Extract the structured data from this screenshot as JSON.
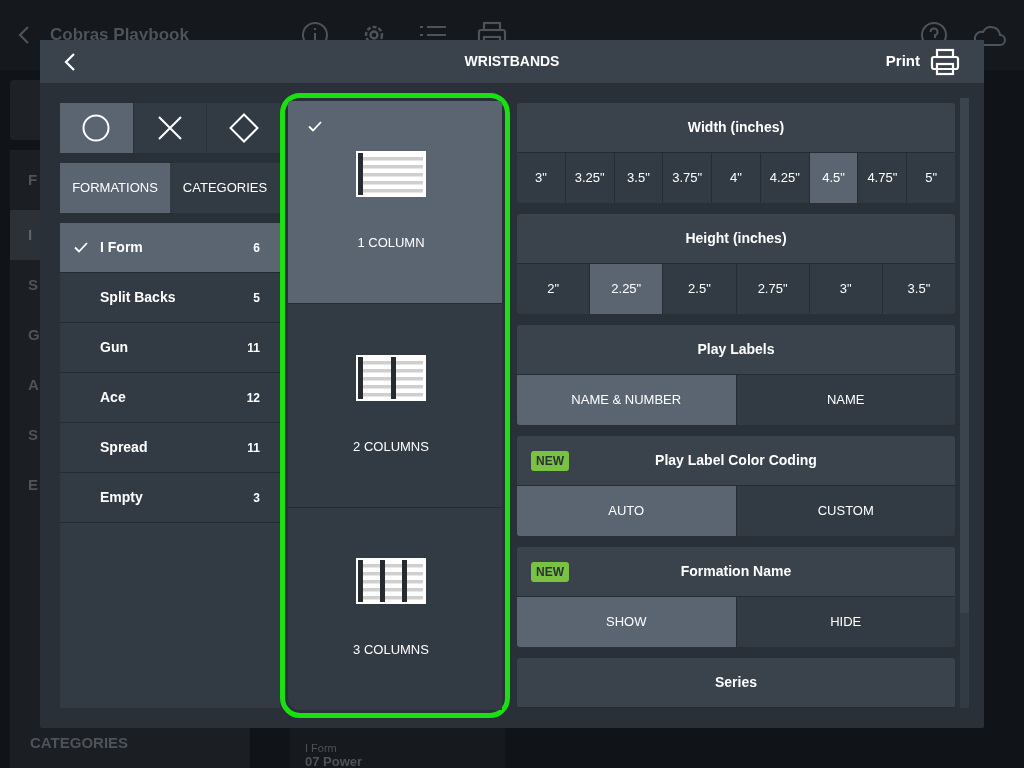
{
  "background": {
    "app_title": "Cobras Playbook",
    "sidebar_heading": "F",
    "sidebar_items": [
      {
        "label": "I",
        "selected": true
      },
      {
        "label": "S",
        "selected": false
      },
      {
        "label": "G",
        "selected": false
      },
      {
        "label": "A",
        "selected": false
      },
      {
        "label": "S",
        "selected": false
      },
      {
        "label": "E",
        "selected": false
      }
    ],
    "categories_label": "CATEGORIES",
    "card_caption": "I Form",
    "card_title": "07 Power"
  },
  "modal": {
    "title": "WRISTBANDS",
    "print_label": "Print"
  },
  "shape_tabs": [
    {
      "kind": "circle",
      "selected": true
    },
    {
      "kind": "cross",
      "selected": false
    },
    {
      "kind": "diamond",
      "selected": false
    }
  ],
  "list_tabs": [
    {
      "label": "FORMATIONS",
      "selected": true
    },
    {
      "label": "CATEGORIES",
      "selected": false
    }
  ],
  "formations": [
    {
      "name": "I Form",
      "count": "6",
      "selected": true
    },
    {
      "name": "Split Backs",
      "count": "5",
      "selected": false
    },
    {
      "name": "Gun",
      "count": "11",
      "selected": false
    },
    {
      "name": "Ace",
      "count": "12",
      "selected": false
    },
    {
      "name": "Spread",
      "count": "11",
      "selected": false
    },
    {
      "name": "Empty",
      "count": "3",
      "selected": false
    }
  ],
  "layouts": [
    {
      "kind": "one",
      "label": "1 COLUMN",
      "selected": true
    },
    {
      "kind": "two",
      "label": "2 COLUMNS",
      "selected": false
    },
    {
      "kind": "three",
      "label": "3 COLUMNS",
      "selected": false
    }
  ],
  "settings": [
    {
      "title": "Width (inches)",
      "options": [
        {
          "label": "3\"",
          "selected": false
        },
        {
          "label": "3.25\"",
          "selected": false
        },
        {
          "label": "3.5\"",
          "selected": false
        },
        {
          "label": "3.75\"",
          "selected": false
        },
        {
          "label": "4\"",
          "selected": false
        },
        {
          "label": "4.25\"",
          "selected": false
        },
        {
          "label": "4.5\"",
          "selected": true
        },
        {
          "label": "4.75\"",
          "selected": false
        },
        {
          "label": "5\"",
          "selected": false
        }
      ]
    },
    {
      "title": "Height (inches)",
      "options": [
        {
          "label": "2\"",
          "selected": false
        },
        {
          "label": "2.25\"",
          "selected": true
        },
        {
          "label": "2.5\"",
          "selected": false
        },
        {
          "label": "2.75\"",
          "selected": false
        },
        {
          "label": "3\"",
          "selected": false
        },
        {
          "label": "3.5\"",
          "selected": false
        }
      ]
    },
    {
      "title": "Play Labels",
      "options": [
        {
          "label": "NAME & NUMBER",
          "selected": true
        },
        {
          "label": "NAME",
          "selected": false
        }
      ]
    },
    {
      "title": "Play Label Color Coding",
      "badge": "NEW",
      "options": [
        {
          "label": "AUTO",
          "selected": true
        },
        {
          "label": "CUSTOM",
          "selected": false
        }
      ]
    },
    {
      "title": "Formation Name",
      "badge": "NEW",
      "options": [
        {
          "label": "SHOW",
          "selected": true
        },
        {
          "label": "HIDE",
          "selected": false
        }
      ]
    },
    {
      "title": "Series"
    }
  ]
}
